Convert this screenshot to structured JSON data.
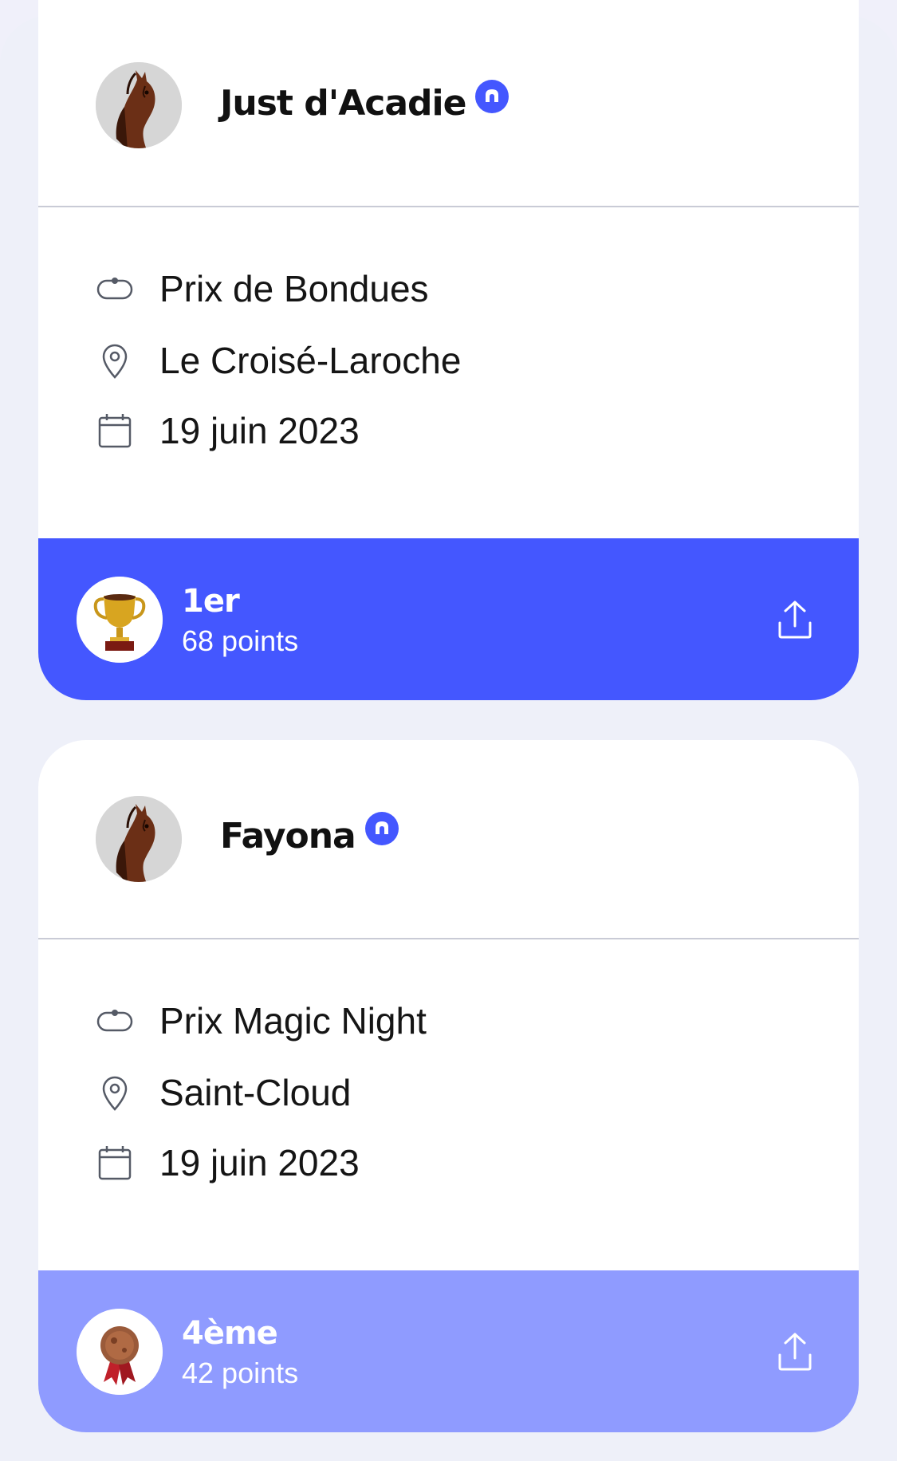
{
  "results": [
    {
      "horse_name": "Just d'Acadie",
      "race": "Prix de Bondues",
      "location": "Le Croisé-Laroche",
      "date": "19 juin 2023",
      "rank": "1er",
      "points": "68 points",
      "medal_icon": "trophy-icon",
      "bar_color": "#4457ff"
    },
    {
      "horse_name": "Fayona",
      "race": "Prix Magic Night",
      "location": "Saint-Cloud",
      "date": "19 juin 2023",
      "rank": "4ème",
      "points": "42 points",
      "medal_icon": "rosette-icon",
      "bar_color": "#8f9bff"
    }
  ],
  "colors": {
    "accent": "#4457ff",
    "accent_light": "#8f9bff",
    "background": "#eef0f9",
    "card": "#ffffff",
    "text": "#151515"
  }
}
